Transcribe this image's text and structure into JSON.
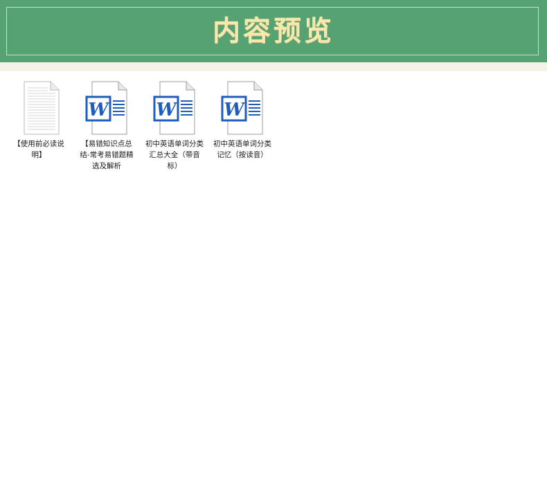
{
  "banner": {
    "title": "内容预览"
  },
  "files": [
    {
      "name": "【使用前必读说明】",
      "type": "txt",
      "icon": "text-document-icon"
    },
    {
      "name": "【易错知识点总结-常考易错题精选及解析",
      "type": "word",
      "icon": "word-document-icon"
    },
    {
      "name": "初中英语单词分类汇总大全（带音标）",
      "type": "word",
      "icon": "word-document-icon"
    },
    {
      "name": "初中英语单词分类记忆（按读音）",
      "type": "word",
      "icon": "word-document-icon"
    }
  ],
  "colors": {
    "banner_bg": "#57a273",
    "banner_title": "#f6e9b0",
    "strip": "#f5f2ea",
    "word_blue": "#1f5dbd"
  }
}
